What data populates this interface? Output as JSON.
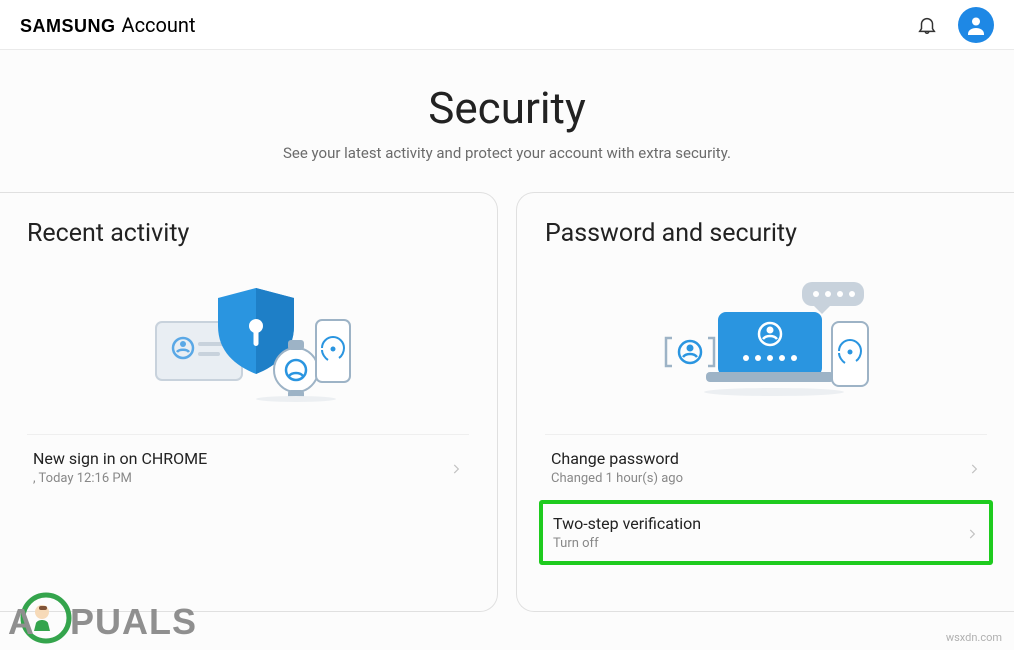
{
  "header": {
    "brand_main": "SAMSUNG",
    "brand_sub": "Account"
  },
  "page": {
    "title": "Security",
    "subtitle": "See your latest activity and protect your account with extra security."
  },
  "recent_activity": {
    "title": "Recent activity",
    "item": {
      "title": "New sign in on CHROME",
      "sub": ", Today 12:16 PM"
    }
  },
  "password_security": {
    "title": "Password and security",
    "change_password": {
      "title": "Change password",
      "sub": "Changed 1 hour(s) ago"
    },
    "two_step": {
      "title": "Two-step verification",
      "sub": "Turn off"
    }
  },
  "watermarks": {
    "site_logo_text": "A   PUALS",
    "source": "wsxdn.com"
  }
}
